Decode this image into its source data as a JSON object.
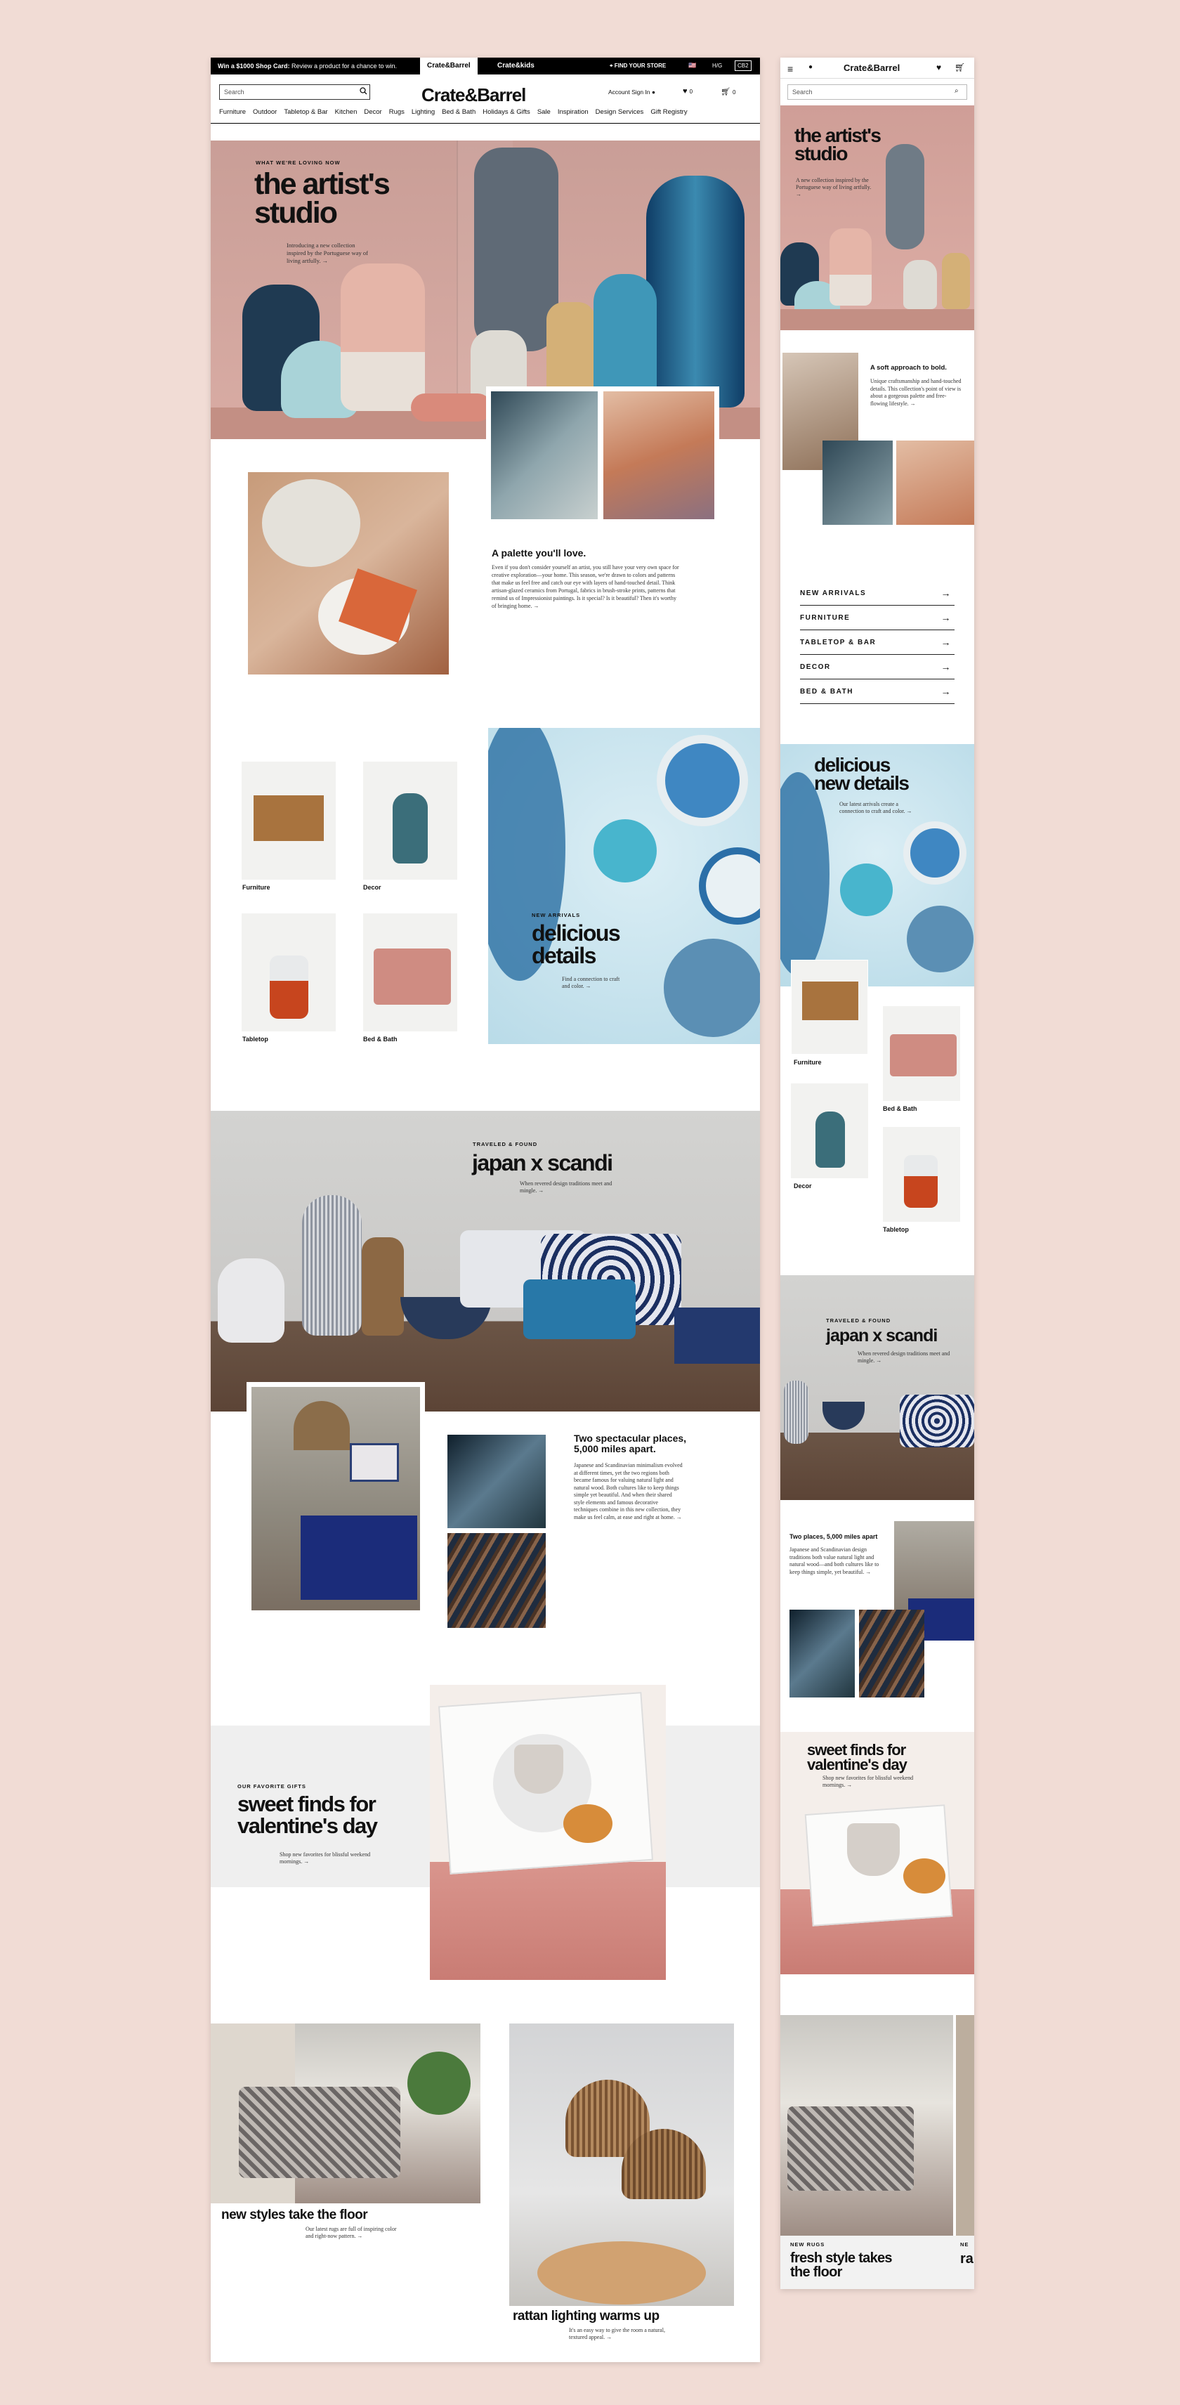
{
  "promo": {
    "bold": "Win a $1000 Shop Card:",
    "text": " Review a product for a chance to win."
  },
  "tabs": [
    "Crate&Barrel",
    "Crate&kids"
  ],
  "utility": {
    "find_store": "FIND YOUR STORE",
    "currency": "🇺🇸",
    "lang": "H/G",
    "cb2": "CB2"
  },
  "header": {
    "search_placeholder": "Search",
    "logo": "Crate&Barrel",
    "account": "Account Sign In",
    "fav_count": "0",
    "cart_count": "0"
  },
  "nav": [
    "Furniture",
    "Outdoor",
    "Tabletop & Bar",
    "Kitchen",
    "Decor",
    "Rugs",
    "Lighting",
    "Bed & Bath",
    "Holidays & Gifts",
    "Sale",
    "Inspiration",
    "Design Services",
    "Gift Registry"
  ],
  "hero": {
    "eyebrow": "WHAT WE'RE LOVING NOW",
    "title_1": "the artist's",
    "title_2": "studio",
    "body": "Introducing a new collection inspired by the Portuguese way of living artfully. →"
  },
  "palette": {
    "title": "A palette you'll love.",
    "body": "Even if you don't consider yourself an artist, you still have your very own space for creative exploration—your home. This season, we're drawn to colors and patterns that make us feel free and catch our eye with layers of hand-touched detail. Think artisan-glazed ceramics from Portugal, fabrics in brush-stroke prints, patterns that remind us of Impressionist paintings. Is it special? Is it beautiful? Then it's worthy of bringing home. →"
  },
  "categories": [
    {
      "label": "Furniture"
    },
    {
      "label": "Decor"
    },
    {
      "label": "Tabletop"
    },
    {
      "label": "Bed & Bath"
    }
  ],
  "new_arrivals": {
    "eyebrow": "NEW ARRIVALS",
    "title_1": "delicious",
    "title_2": "details",
    "body": "Find a connection to craft and color. →"
  },
  "japan": {
    "eyebrow": "TRAVELED & FOUND",
    "title": "japan x scandi",
    "body": "When revered design traditions meet and mingle. →"
  },
  "two_places": {
    "title_1": "Two spectacular places,",
    "title_2": "5,000 miles apart.",
    "body": "Japanese and Scandinavian minimalism evolved at different times, yet the two regions both became famous for valuing natural light and natural wood. Both cultures like to keep things simple yet beautiful. And when their shared style elements and famous decorative techniques combine in this new collection, they make us feel calm, at ease and right at home. →"
  },
  "gifts": {
    "eyebrow": "OUR FAVORITE GIFTS",
    "title_1": "sweet finds for",
    "title_2": "valentine's day",
    "body": "Shop new favorites for blissful weekend mornings. →"
  },
  "rugs": {
    "title": "new styles take the floor",
    "body": "Our latest rugs are full of inspiring color and right-now pattern. →"
  },
  "lighting": {
    "title": "rattan lighting warms up",
    "body": "It's an easy way to give the room a natural, textured appeal. →"
  },
  "mobile": {
    "logo": "Crate&Barrel",
    "search_placeholder": "Search",
    "hero_title_1": "the artist's",
    "hero_title_2": "studio",
    "hero_body": "A new collection inspired by the Portuguese way of living artfully. →",
    "bold_title": "A soft approach to bold.",
    "bold_body": "Unique craftsmanship and hand-touched details. This collection's point of view is about a gorgeous palette and free-flowing lifestyle. →",
    "menu": [
      "NEW ARRIVALS",
      "FURNITURE",
      "TABLETOP & BAR",
      "DECOR",
      "BED & BATH"
    ],
    "nd_title_1": "delicious",
    "nd_title_2": "new details",
    "nd_body": "Our latest arrivals create a connection to craft and color. →",
    "cats": [
      "Furniture",
      "Bed & Bath",
      "Decor",
      "Tabletop"
    ],
    "japan_eyebrow": "TRAVELED & FOUND",
    "japan_title": "japan x scandi",
    "japan_body": "When revered design traditions meet and mingle. →",
    "two_title": "Two places, 5,000 miles apart",
    "two_body": "Japanese and Scandinavian design traditions both value natural light and natural wood—and both cultures like to keep things simple, yet beautiful. →",
    "sweet_title_1": "sweet finds for",
    "sweet_title_2": "valentine's day",
    "sweet_body": "Shop new favorites for blissful weekend mornings. →",
    "rugs_eyebrow": "NEW RUGS",
    "rugs_eyebrow_2": "NE",
    "rugs_title_1": "fresh style takes",
    "rugs_title_2": "the floor",
    "rugs_title_cut": "ra"
  },
  "colors": {
    "background": "#f1dcd5",
    "hero_pink": "#d4a39b",
    "ink": "#111111",
    "blue": "#1e3a8a"
  }
}
